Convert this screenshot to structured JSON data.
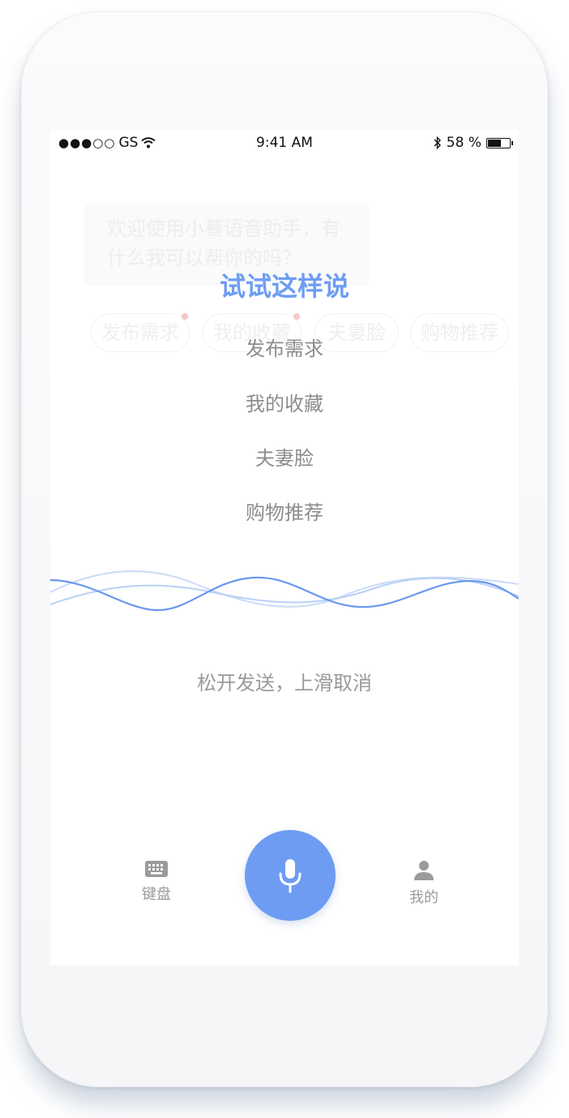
{
  "status_bar": {
    "carrier": "GS",
    "time": "9:41 AM",
    "battery": "58 %",
    "battery_level": 0.58
  },
  "background": {
    "welcome_text": "欢迎使用小蓦语音助手，有什么我可以帮你的吗？",
    "chips": [
      "发布需求",
      "我的收藏",
      "夫妻脸",
      "购物推荐"
    ]
  },
  "hints": {
    "title": "试试这样说",
    "items": [
      "发布需求",
      "我的收藏",
      "夫妻脸",
      "购物推荐"
    ]
  },
  "release_text": "松开发送，上滑取消",
  "tabbar": {
    "keyboard_label": "键盘",
    "mine_label": "我的"
  },
  "colors": {
    "accent": "#6d9cf2",
    "wave_dark": "#6a98ee",
    "wave_light": "#b8d0f7"
  },
  "icons": [
    "signal-icon",
    "wifi-icon",
    "bluetooth-icon",
    "battery-icon",
    "keyboard-icon",
    "microphone-icon",
    "person-icon"
  ]
}
